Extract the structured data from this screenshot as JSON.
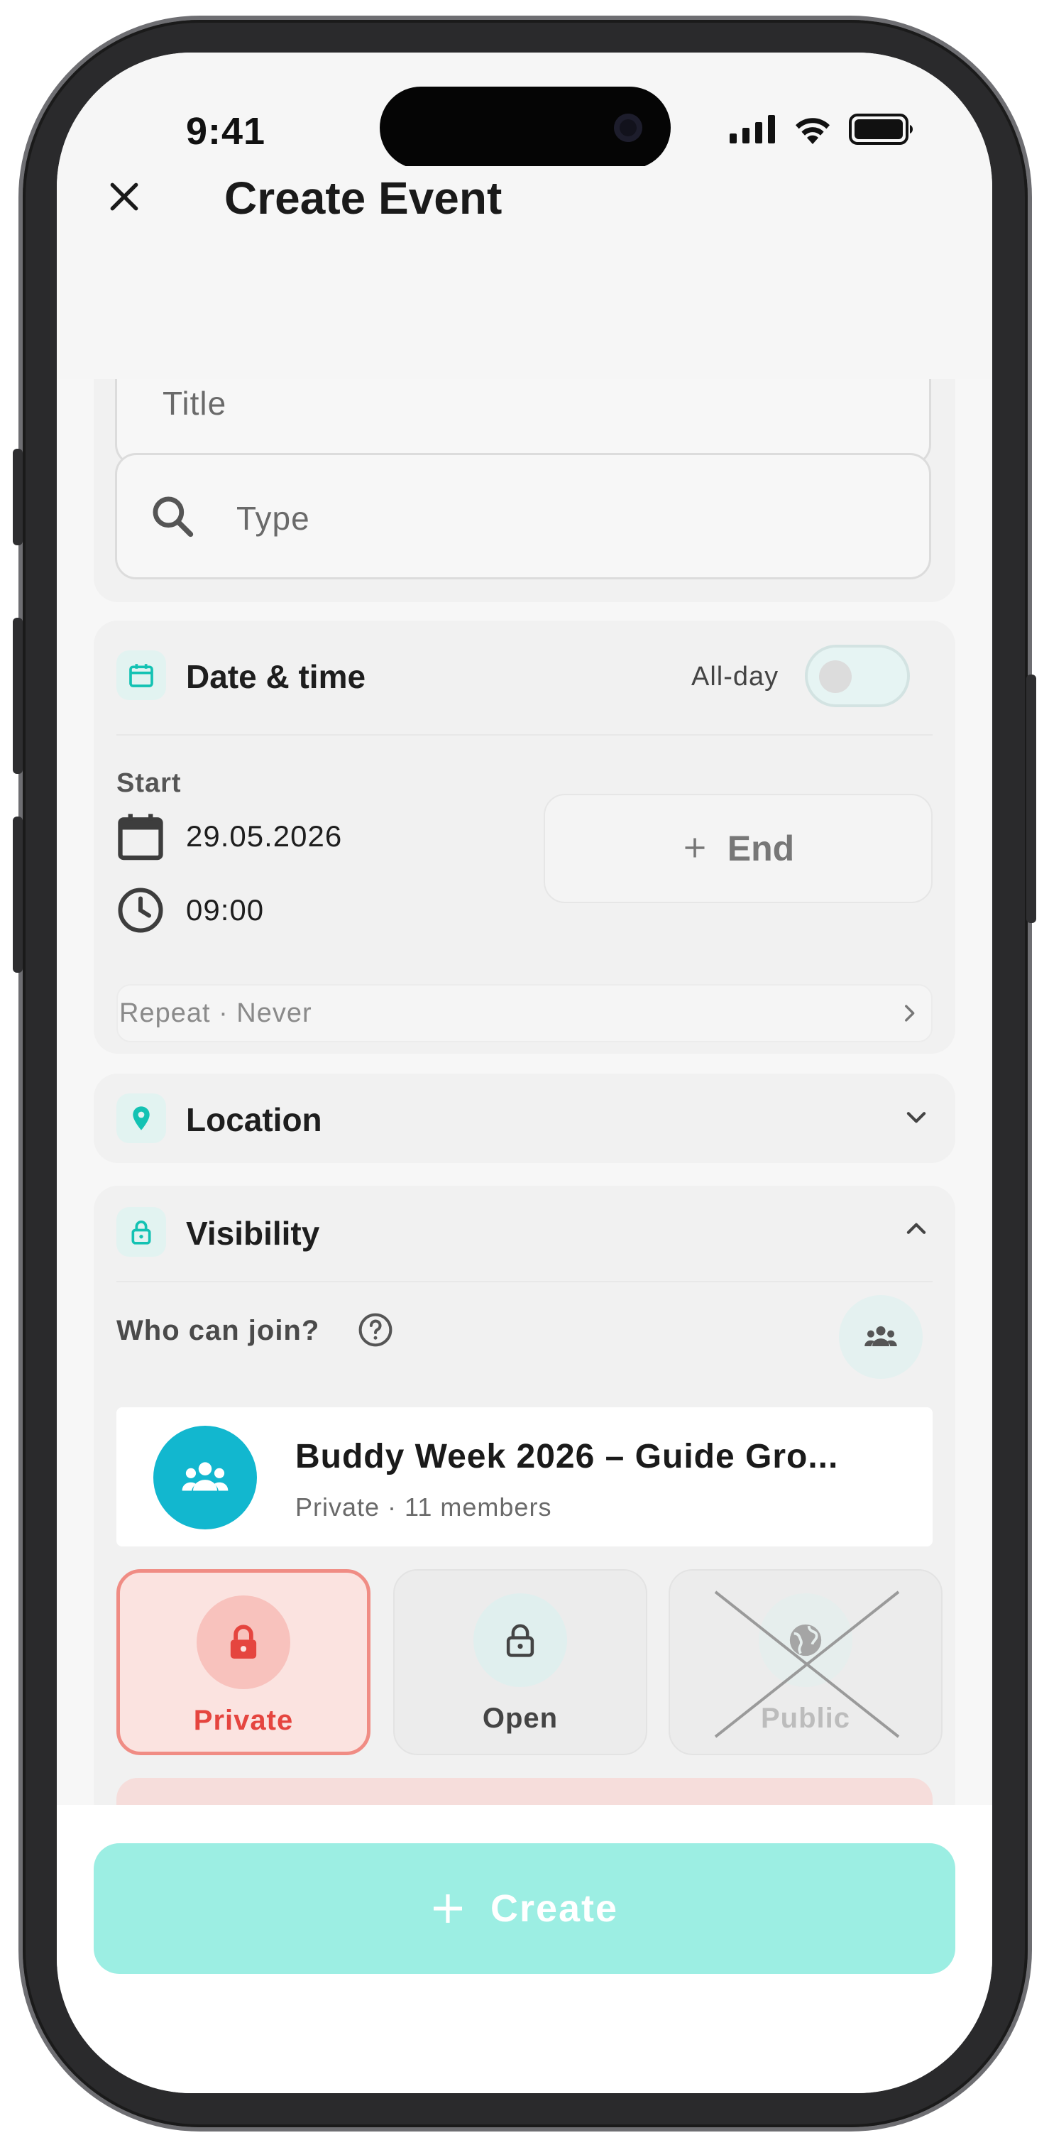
{
  "status_bar": {
    "time": "9:41",
    "icons": [
      "cellular-signal-icon",
      "wifi-icon",
      "battery-icon"
    ]
  },
  "header": {
    "title": "Create Event",
    "close_icon": "close-icon"
  },
  "form": {
    "title_placeholder": "Title",
    "type_placeholder": "Type"
  },
  "date_time": {
    "section_title": "Date & time",
    "all_day_label": "All-day",
    "all_day_on": false,
    "start_label": "Start",
    "start_date": "29.05.2026",
    "start_time": "09:00",
    "end_label": "End",
    "repeat_text": "Repeat · Never"
  },
  "location": {
    "section_title": "Location"
  },
  "visibility": {
    "section_title": "Visibility",
    "who_can_join": "Who can join?",
    "group": {
      "name": "Buddy Week 2026 – Guide Gro...",
      "meta": "Private · 11 members"
    },
    "options": [
      {
        "label": "Private",
        "selected": true,
        "disabled": false
      },
      {
        "label": "Open",
        "selected": false,
        "disabled": false
      },
      {
        "label": "Public",
        "selected": false,
        "disabled": true
      }
    ]
  },
  "footer": {
    "create_label": "Create"
  },
  "colors": {
    "accent": "#13c2b3",
    "private_red": "#e5453f",
    "create_button": "#9ceee3"
  }
}
